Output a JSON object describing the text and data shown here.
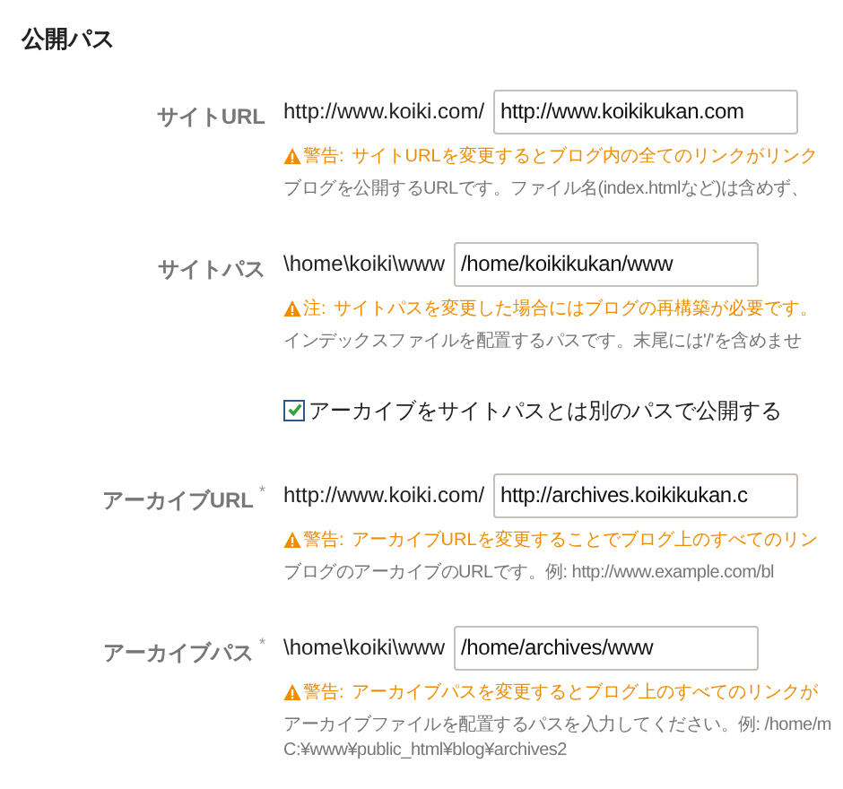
{
  "section_title": "公開パス",
  "fields": [
    {
      "kind": "text_field",
      "label": "サイトURL",
      "prefix": "http://www.koiki.com/",
      "value": "http://www.koikikukan.com",
      "warning_label": "警告:",
      "warning": "サイトURLを変更するとブログ内の全てのリンクがリンク",
      "help": [
        "ブログを公開するURLです。ファイル名(index.htmlなど)は含めず、"
      ]
    },
    {
      "kind": "text_field",
      "label": "サイトパス",
      "prefix": "\\home\\koiki\\www",
      "value": "/home/koikikukan/www",
      "warning_label": "注:",
      "warning": "サイトパスを変更した場合にはブログの再構築が必要です。",
      "help": [
        "インデックスファイルを配置するパスです。末尾には'/'を含めませ"
      ]
    },
    {
      "kind": "checkbox",
      "label": "アーカイブをサイトパスとは別のパスで公開する",
      "checked": true
    },
    {
      "kind": "text_field",
      "label": "アーカイブURL",
      "required_mark": "*",
      "prefix": "http://www.koiki.com/",
      "value": "http://archives.koikikukan.c",
      "warning_label": "警告:",
      "warning": "アーカイブURLを変更することでブログ上のすべてのリン",
      "help": [
        "ブログのアーカイブのURLです。例: http://www.example.com/bl"
      ]
    },
    {
      "kind": "text_field",
      "label": "アーカイブパス",
      "required_mark": "*",
      "prefix": "\\home\\koiki\\www",
      "value": "/home/archives/www",
      "warning_label": "警告:",
      "warning": "アーカイブパスを変更するとブログ上のすべてのリンクが",
      "help": [
        "アーカイブファイルを配置するパスを入力してください。例: /home/m",
        "C:¥www¥public_html¥blog¥archives2"
      ]
    }
  ]
}
